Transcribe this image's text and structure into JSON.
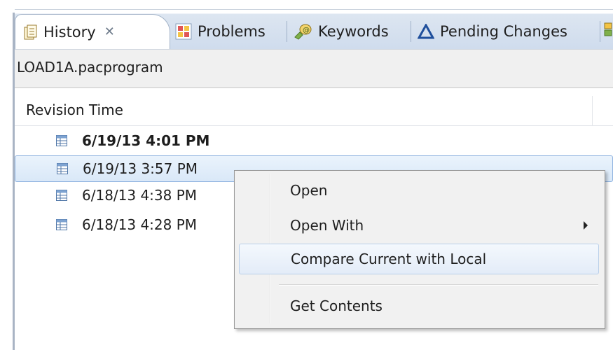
{
  "tabs": [
    {
      "label": "History",
      "icon": "history-icon",
      "active": true,
      "close": "✕"
    },
    {
      "label": "Problems",
      "icon": "problems-icon"
    },
    {
      "label": "Keywords",
      "icon": "keywords-icon"
    },
    {
      "label": "Pending Changes",
      "icon": "pending-changes-icon"
    }
  ],
  "resource": "LOAD1A.pacprogram",
  "table": {
    "column": "Revision Time",
    "rows": [
      {
        "time": "6/19/13 4:01 PM",
        "bold": true
      },
      {
        "time": "6/19/13 3:57 PM",
        "selected": true
      },
      {
        "time": "6/18/13 4:38 PM"
      },
      {
        "time": "6/18/13 4:28 PM"
      }
    ]
  },
  "context_menu": {
    "items": [
      {
        "label": "Open"
      },
      {
        "label": "Open With",
        "submenu": true
      },
      {
        "label": "Compare Current with Local",
        "hovered": true
      },
      {
        "label": "Get Contents"
      }
    ]
  },
  "colors": {
    "tab_bar": "#cfdced",
    "selection_border": "#8fb3e0",
    "menu_background": "#f1f1f1"
  }
}
